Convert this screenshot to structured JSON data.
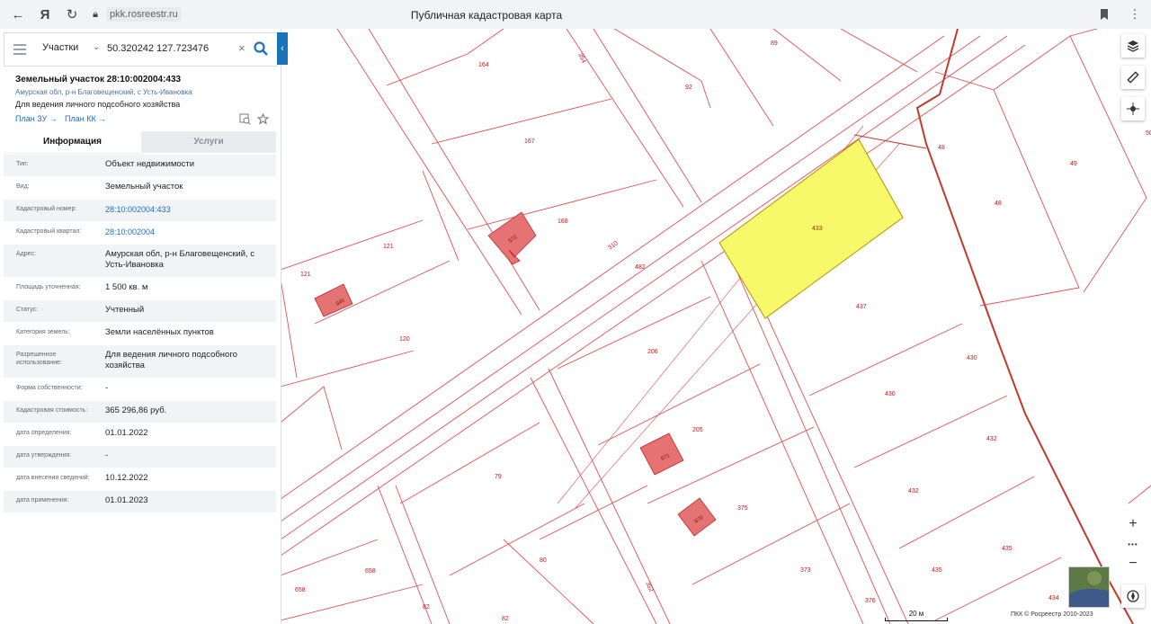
{
  "browser": {
    "url": "pkk.rosreestr.ru",
    "page_title": "Публичная кадастровая карта",
    "icons": [
      "back-arrow-icon",
      "yandex-logo-icon",
      "reload-icon",
      "lock-icon",
      "bookmark-icon",
      "menu-dots-icon"
    ]
  },
  "search": {
    "category": "Участки",
    "query": "50.320242 127.723476",
    "clear_symbol": "×"
  },
  "object": {
    "title": "Земельный участок 28:10:002004:433",
    "address": "Амурская обл, р-н Благовещенский, с Усть-Ивановка",
    "purpose": "Для ведения личного подсобного хозяйства",
    "plan_zu": "План ЗУ →",
    "plan_kk": "План КК →"
  },
  "tabs": {
    "info": "Информация",
    "services": "Услуги"
  },
  "attributes": [
    {
      "key": "Тип:",
      "value": "Объект недвижимости"
    },
    {
      "key": "Вид:",
      "value": "Земельный участок"
    },
    {
      "key": "Кадастровый номер:",
      "value": "28:10:002004:433"
    },
    {
      "key": "Кадастровый квартал:",
      "value": "28:10:002004"
    },
    {
      "key": "Адрес:",
      "value": "Амурская обл, р-н Благовещенский, с Усть-Ивановка"
    },
    {
      "key": "Площадь уточненная:",
      "value": "1 500 кв. м"
    },
    {
      "key": "Статус:",
      "value": "Учтенный"
    },
    {
      "key": "Категория земель:",
      "value": "Земли населённых пунктов"
    },
    {
      "key": "Разрешенное использование:",
      "value": "Для ведения личного подсобного хозяйства"
    },
    {
      "key": "Форма собственности:",
      "value": "-"
    },
    {
      "key": "Кадастровая стоимость:",
      "value": "365 296,86 руб."
    },
    {
      "key": "дата определения:",
      "value": "01.01.2022"
    },
    {
      "key": "дата утверждения:",
      "value": "-"
    },
    {
      "key": "дата внесения сведений:",
      "value": "10.12.2022"
    },
    {
      "key": "дата применения:",
      "value": "01.01.2023"
    }
  ],
  "map": {
    "parcel_labels": [
      "164",
      "89",
      "92",
      "167",
      "168",
      "121",
      "121",
      "120",
      "48",
      "48",
      "49",
      "50",
      "433",
      "437",
      "430",
      "430",
      "482",
      "206",
      "205",
      "432",
      "432",
      "79",
      "80",
      "375",
      "373",
      "435",
      "435",
      "376",
      "434",
      "658",
      "658",
      "82",
      "82"
    ],
    "building_labels": [
      "572",
      "640",
      "671",
      "670"
    ],
    "road_labels": [
      "354",
      "310",
      "352"
    ],
    "highlight_color": "#f7f96b",
    "scale_label": "20 м",
    "copyright": "ПКК © Росреестр 2010-2023",
    "controls": [
      "layers-icon",
      "ruler-icon",
      "locate-icon",
      "zoom-in",
      "more",
      "zoom-out",
      "compass-icon"
    ],
    "zoom_in": "+",
    "zoom_out": "−",
    "more": "•••"
  }
}
